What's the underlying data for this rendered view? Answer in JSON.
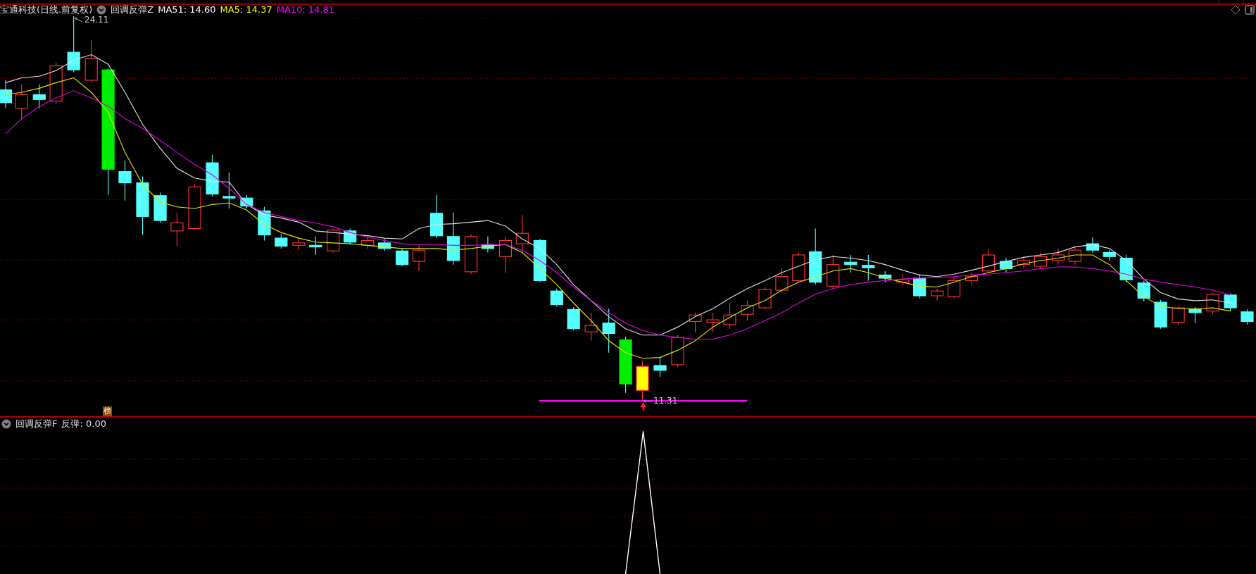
{
  "main_panel": {
    "stock_title": "宝通科技(日线.前复权)",
    "indicator_name": "回调反弹Z",
    "moving_averages": [
      {
        "label": "MA51: 14.60",
        "color": "#ffffff"
      },
      {
        "label": "MA5: 14.37",
        "color": "#ffff00"
      },
      {
        "label": "MA10: 14.81",
        "color": "#ff00ff"
      }
    ],
    "high_label": "24.11",
    "low_label": "11.31",
    "badge": "榜"
  },
  "lower_panel": {
    "indicator_name": "回调反弹F",
    "value_label": "反弹: 0.00"
  }
}
